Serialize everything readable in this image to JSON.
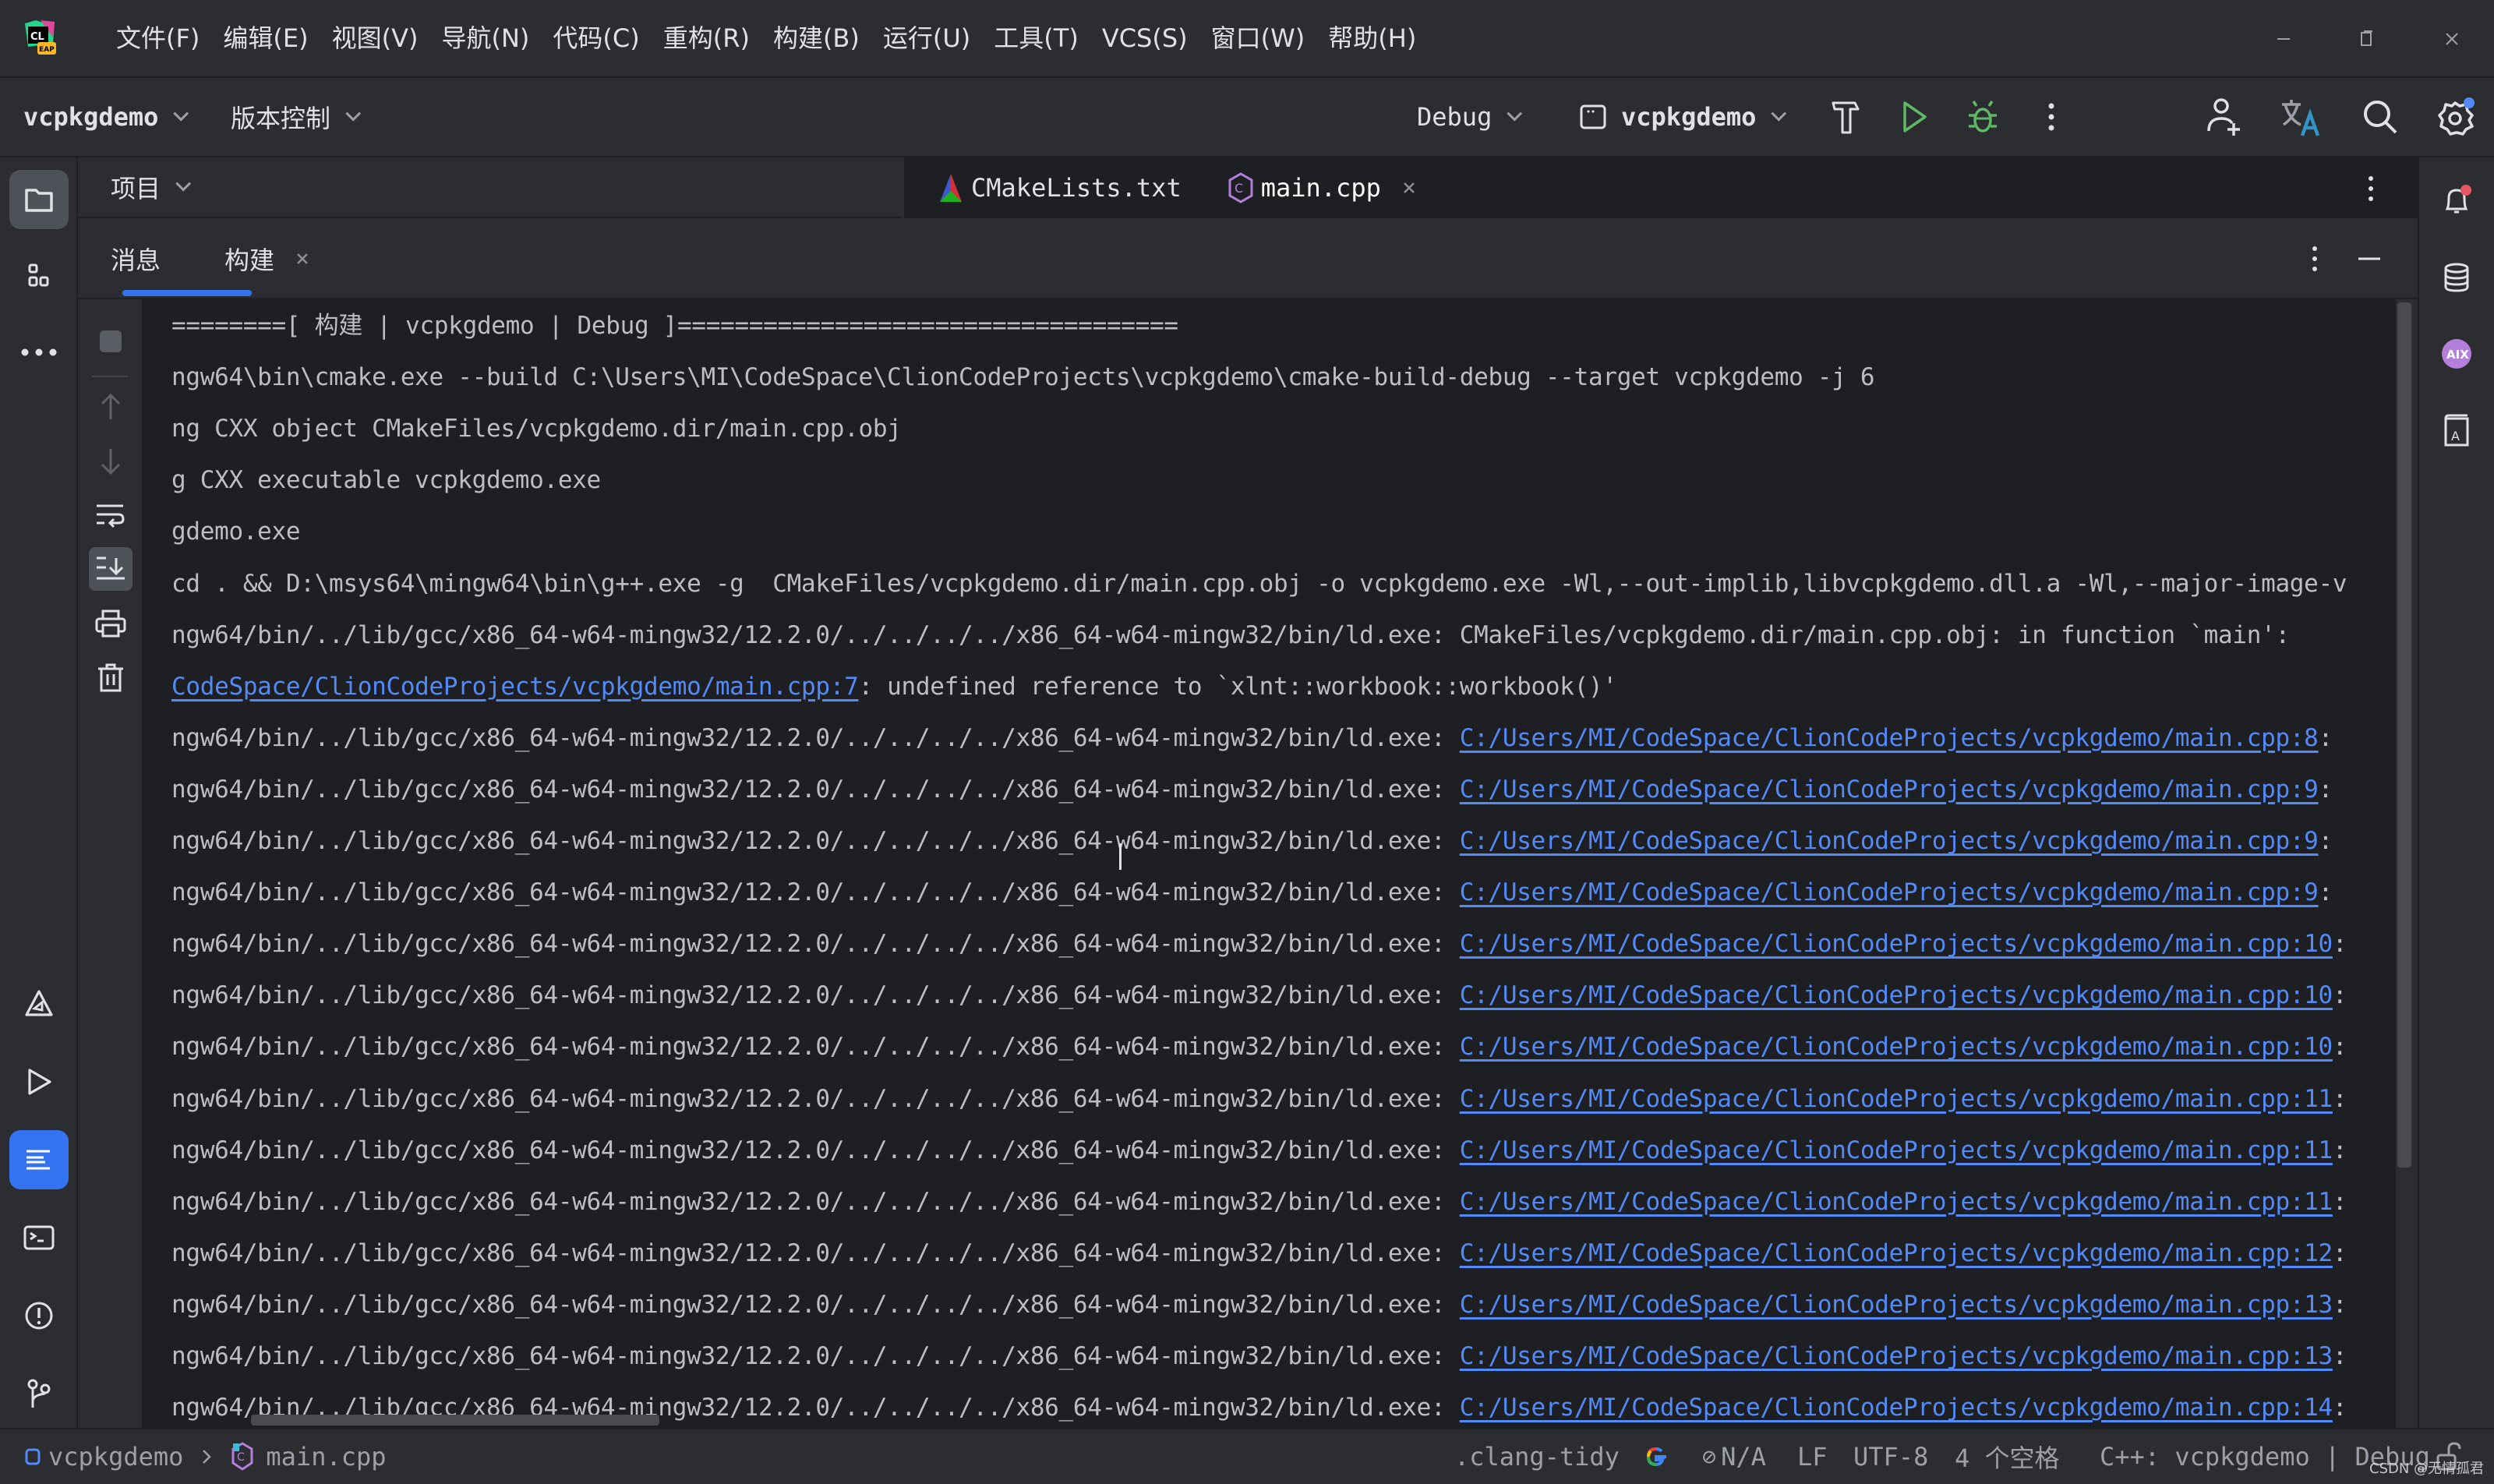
{
  "app": {
    "logo_text": "CL",
    "logo_badge": "EAP"
  },
  "menu": [
    {
      "label": "文件(F)"
    },
    {
      "label": "编辑(E)"
    },
    {
      "label": "视图(V)"
    },
    {
      "label": "导航(N)"
    },
    {
      "label": "代码(C)"
    },
    {
      "label": "重构(R)"
    },
    {
      "label": "构建(B)"
    },
    {
      "label": "运行(U)"
    },
    {
      "label": "工具(T)"
    },
    {
      "label": "VCS(S)"
    },
    {
      "label": "窗口(W)"
    },
    {
      "label": "帮助(H)"
    }
  ],
  "window_controls": {
    "minimize": "—",
    "restore": "❐",
    "close": "✕"
  },
  "toolbar": {
    "project_name": "vcpkgdemo",
    "vcs_label": "版本控制",
    "build_config": "Debug",
    "run_target": "vcpkgdemo"
  },
  "project_panel": {
    "label": "项目"
  },
  "editor_tabs": [
    {
      "label": "CMakeLists.txt",
      "icon": "cmake-icon"
    },
    {
      "label": "main.cpp",
      "icon": "cpp-file-icon",
      "closable": true
    }
  ],
  "build_panel": {
    "tabs": [
      {
        "label": "消息"
      },
      {
        "label": "构建",
        "active": true,
        "closable": true
      }
    ]
  },
  "console": {
    "lines": [
      {
        "text": "========[ 构建 | vcpkgdemo | Debug ]==================================="
      },
      {
        "text": "ngw64\\bin\\cmake.exe --build C:\\Users\\MI\\CodeSpace\\ClionCodeProjects\\vcpkgdemo\\cmake-build-debug --target vcpkgdemo -j 6"
      },
      {
        "text": "ng CXX object CMakeFiles/vcpkgdemo.dir/main.cpp.obj"
      },
      {
        "text": "g CXX executable vcpkgdemo.exe"
      },
      {
        "text": "gdemo.exe"
      },
      {
        "text": "cd . && D:\\msys64\\mingw64\\bin\\g++.exe -g  CMakeFiles/vcpkgdemo.dir/main.cpp.obj -o vcpkgdemo.exe -Wl,--out-implib,libvcpkgdemo.dll.a -Wl,--major-image-v"
      },
      {
        "text": "ngw64/bin/../lib/gcc/x86_64-w64-mingw32/12.2.0/../../../../x86_64-w64-mingw32/bin/ld.exe: CMakeFiles/vcpkgdemo.dir/main.cpp.obj: in function `main':"
      },
      {
        "prefix": "",
        "link": "CodeSpace/ClionCodeProjects/vcpkgdemo/main.cpp:7",
        "suffix": ": undefined reference to `xlnt::workbook::workbook()'"
      },
      {
        "prefix": "ngw64/bin/../lib/gcc/x86_64-w64-mingw32/12.2.0/../../../../x86_64-w64-mingw32/bin/ld.exe: ",
        "link": "C:/Users/MI/CodeSpace/ClionCodeProjects/vcpkgdemo/main.cpp:8",
        "suffix": ":"
      },
      {
        "prefix": "ngw64/bin/../lib/gcc/x86_64-w64-mingw32/12.2.0/../../../../x86_64-w64-mingw32/bin/ld.exe: ",
        "link": "C:/Users/MI/CodeSpace/ClionCodeProjects/vcpkgdemo/main.cpp:9",
        "suffix": ":"
      },
      {
        "prefix": "ngw64/bin/../lib/gcc/x86_64-w64-mingw32/12.2.0/../../../../x86_64-w64-mingw32/bin/ld.exe: ",
        "link": "C:/Users/MI/CodeSpace/ClionCodeProjects/vcpkgdemo/main.cpp:9",
        "suffix": ":"
      },
      {
        "prefix": "ngw64/bin/../lib/gcc/x86_64-w64-mingw32/12.2.0/../../../../x86_64-w64-mingw32/bin/ld.exe: ",
        "link": "C:/Users/MI/CodeSpace/ClionCodeProjects/vcpkgdemo/main.cpp:9",
        "suffix": ":"
      },
      {
        "prefix": "ngw64/bin/../lib/gcc/x86_64-w64-mingw32/12.2.0/../../../../x86_64-w64-mingw32/bin/ld.exe: ",
        "link": "C:/Users/MI/CodeSpace/ClionCodeProjects/vcpkgdemo/main.cpp:10",
        "suffix": ":"
      },
      {
        "prefix": "ngw64/bin/../lib/gcc/x86_64-w64-mingw32/12.2.0/../../../../x86_64-w64-mingw32/bin/ld.exe: ",
        "link": "C:/Users/MI/CodeSpace/ClionCodeProjects/vcpkgdemo/main.cpp:10",
        "suffix": ":"
      },
      {
        "prefix": "ngw64/bin/../lib/gcc/x86_64-w64-mingw32/12.2.0/../../../../x86_64-w64-mingw32/bin/ld.exe: ",
        "link": "C:/Users/MI/CodeSpace/ClionCodeProjects/vcpkgdemo/main.cpp:10",
        "suffix": ":"
      },
      {
        "prefix": "ngw64/bin/../lib/gcc/x86_64-w64-mingw32/12.2.0/../../../../x86_64-w64-mingw32/bin/ld.exe: ",
        "link": "C:/Users/MI/CodeSpace/ClionCodeProjects/vcpkgdemo/main.cpp:11",
        "suffix": ":"
      },
      {
        "prefix": "ngw64/bin/../lib/gcc/x86_64-w64-mingw32/12.2.0/../../../../x86_64-w64-mingw32/bin/ld.exe: ",
        "link": "C:/Users/MI/CodeSpace/ClionCodeProjects/vcpkgdemo/main.cpp:11",
        "suffix": ":"
      },
      {
        "prefix": "ngw64/bin/../lib/gcc/x86_64-w64-mingw32/12.2.0/../../../../x86_64-w64-mingw32/bin/ld.exe: ",
        "link": "C:/Users/MI/CodeSpace/ClionCodeProjects/vcpkgdemo/main.cpp:11",
        "suffix": ":"
      },
      {
        "prefix": "ngw64/bin/../lib/gcc/x86_64-w64-mingw32/12.2.0/../../../../x86_64-w64-mingw32/bin/ld.exe: ",
        "link": "C:/Users/MI/CodeSpace/ClionCodeProjects/vcpkgdemo/main.cpp:12",
        "suffix": ":"
      },
      {
        "prefix": "ngw64/bin/../lib/gcc/x86_64-w64-mingw32/12.2.0/../../../../x86_64-w64-mingw32/bin/ld.exe: ",
        "link": "C:/Users/MI/CodeSpace/ClionCodeProjects/vcpkgdemo/main.cpp:13",
        "suffix": ":"
      },
      {
        "prefix": "ngw64/bin/../lib/gcc/x86_64-w64-mingw32/12.2.0/../../../../x86_64-w64-mingw32/bin/ld.exe: ",
        "link": "C:/Users/MI/CodeSpace/ClionCodeProjects/vcpkgdemo/main.cpp:13",
        "suffix": ":"
      },
      {
        "prefix": "ngw64/bin/../lib/gcc/x86_64-w64-mingw32/12.2.0/../../../../x86_64-w64-mingw32/bin/ld.exe: ",
        "link": "C:/Users/MI/CodeSpace/ClionCodeProjects/vcpkgdemo/main.cpp:14",
        "suffix": ":"
      }
    ]
  },
  "statusbar": {
    "breadcrumb": [
      {
        "label": "vcpkgdemo"
      },
      {
        "label": "main.cpp"
      }
    ],
    "clang_tidy": ".clang-tidy",
    "na": "N/A",
    "line_ending": "LF",
    "encoding": "UTF-8",
    "indent": "4 个空格",
    "context": "C++: vcpkgdemo | Debug"
  },
  "watermark": "CSDN @无情孤君",
  "colors": {
    "accent": "#3574f0",
    "link": "#548af7",
    "run_green": "#5fb865",
    "notification_red": "#e55765",
    "ai_purple": "#b47fdb"
  }
}
